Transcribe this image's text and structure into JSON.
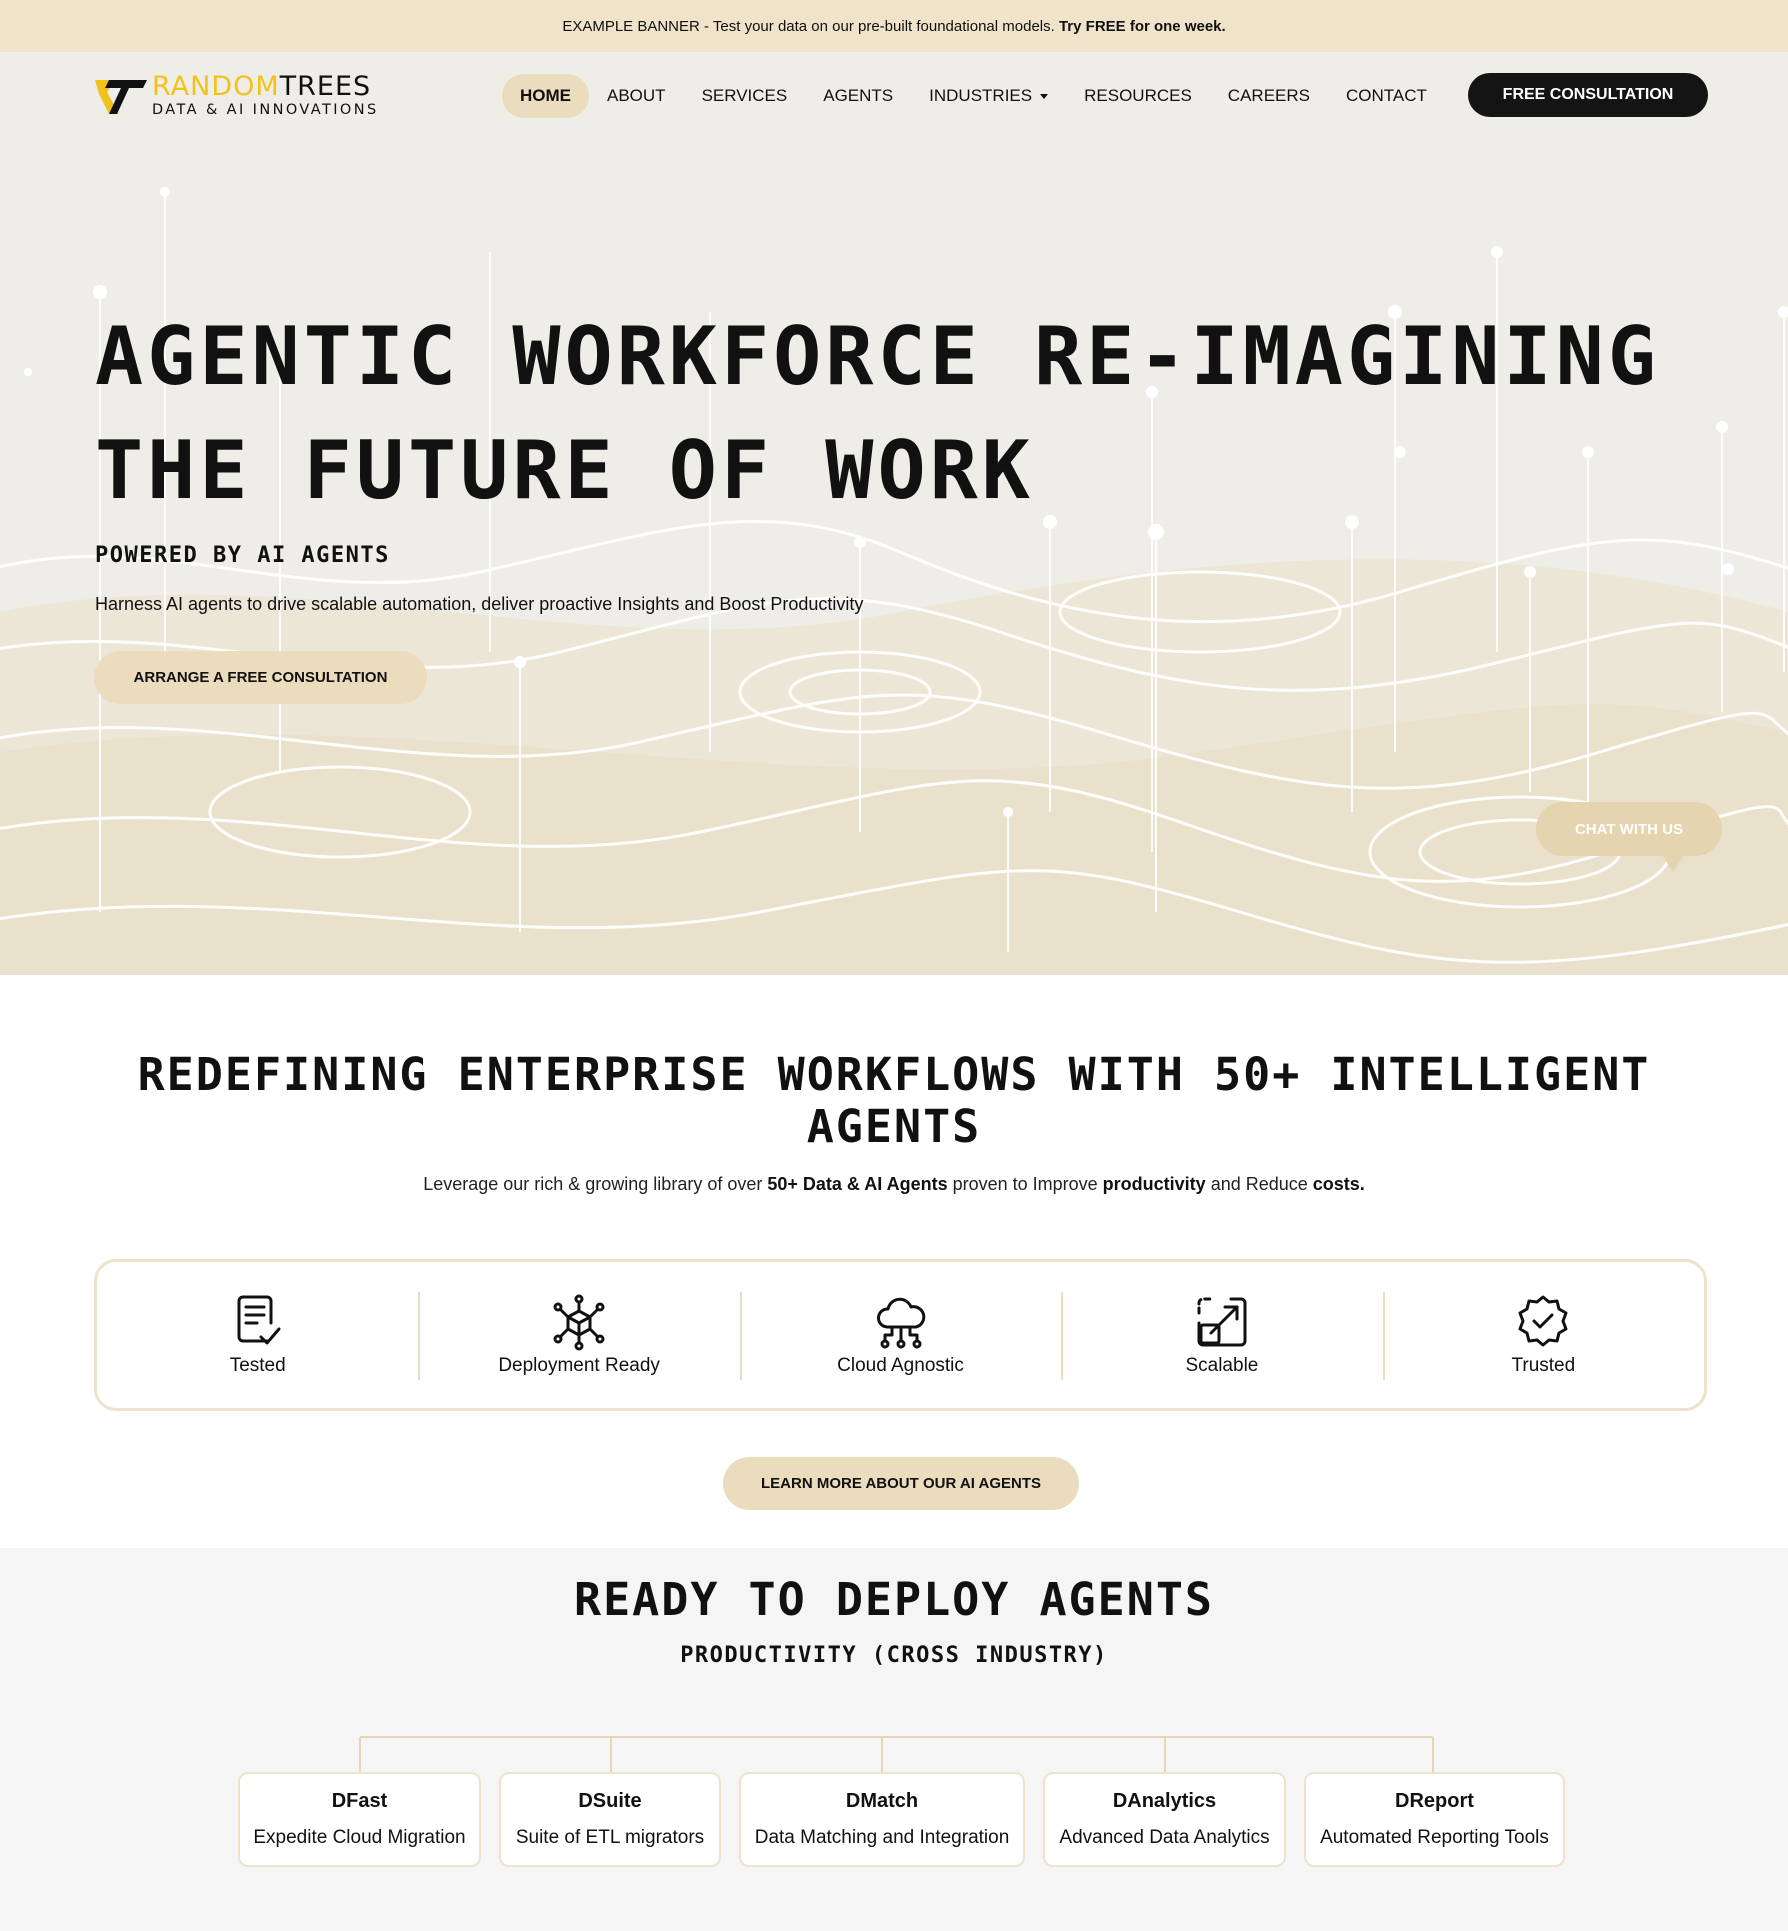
{
  "banner": {
    "prefix": "EXAMPLE BANNER - Test your data on our pre-built foundational models.",
    "emphasis": "Try FREE for one week."
  },
  "logo": {
    "brand_part1": "RANDOM",
    "brand_part2": "TREES",
    "tagline": "DATA & AI INNOVATIONS",
    "accent_color": "#f3c21a"
  },
  "nav": {
    "items": [
      {
        "label": "HOME",
        "active": true
      },
      {
        "label": "ABOUT"
      },
      {
        "label": "SERVICES"
      },
      {
        "label": "AGENTS"
      },
      {
        "label": "INDUSTRIES",
        "dropdown": true
      },
      {
        "label": "RESOURCES"
      },
      {
        "label": "CAREERS"
      },
      {
        "label": "CONTACT"
      }
    ],
    "cta": "FREE CONSULTATION"
  },
  "hero": {
    "title_line1": "AGENTIC WORKFORCE RE-IMAGINING",
    "title_line2": "THE FUTURE OF WORK",
    "subtitle": "POWERED BY AI AGENTS",
    "description": "Harness AI agents to drive scalable automation, deliver proactive Insights and Boost Productivity",
    "button": "ARRANGE A FREE CONSULTATION"
  },
  "chat": {
    "label": "CHAT WITH US"
  },
  "workflows": {
    "title_line1": "REDEFINING ENTERPRISE WORKFLOWS WITH 50+ INTELLIGENT",
    "title_line2": "AGENTS",
    "desc_1": "Leverage our rich & growing library of over ",
    "desc_b1": "50+ Data & AI Agents",
    "desc_2": " proven to Improve ",
    "desc_b2": "productivity",
    "desc_3": " and Reduce ",
    "desc_b3": "costs.",
    "features": [
      {
        "label": "Tested",
        "icon": "checklist-document-icon"
      },
      {
        "label": "Deployment Ready",
        "icon": "network-cube-icon"
      },
      {
        "label": "Cloud Agnostic",
        "icon": "cloud-network-icon"
      },
      {
        "label": "Scalable",
        "icon": "resize-arrows-icon"
      },
      {
        "label": "Trusted",
        "icon": "verified-badge-icon"
      }
    ],
    "button": "LEARN MORE ABOUT OUR AI AGENTS"
  },
  "deploy": {
    "title": "READY TO DEPLOY AGENTS",
    "subtitle": "PRODUCTIVITY (CROSS INDUSTRY)",
    "cards": [
      {
        "title": "DFast",
        "desc": "Expedite Cloud Migration"
      },
      {
        "title": "DSuite",
        "desc": "Suite of ETL migrators"
      },
      {
        "title": "DMatch",
        "desc": "Data Matching and Integration"
      },
      {
        "title": "DAnalytics",
        "desc": "Advanced Data Analytics"
      },
      {
        "title": "DReport",
        "desc": "Automated Reporting Tools"
      }
    ]
  },
  "colors": {
    "banner_bg": "#efe3c9",
    "accent_beige": "#ebdcbd",
    "dark_button": "#141414",
    "hero_bg": "#efede8"
  }
}
